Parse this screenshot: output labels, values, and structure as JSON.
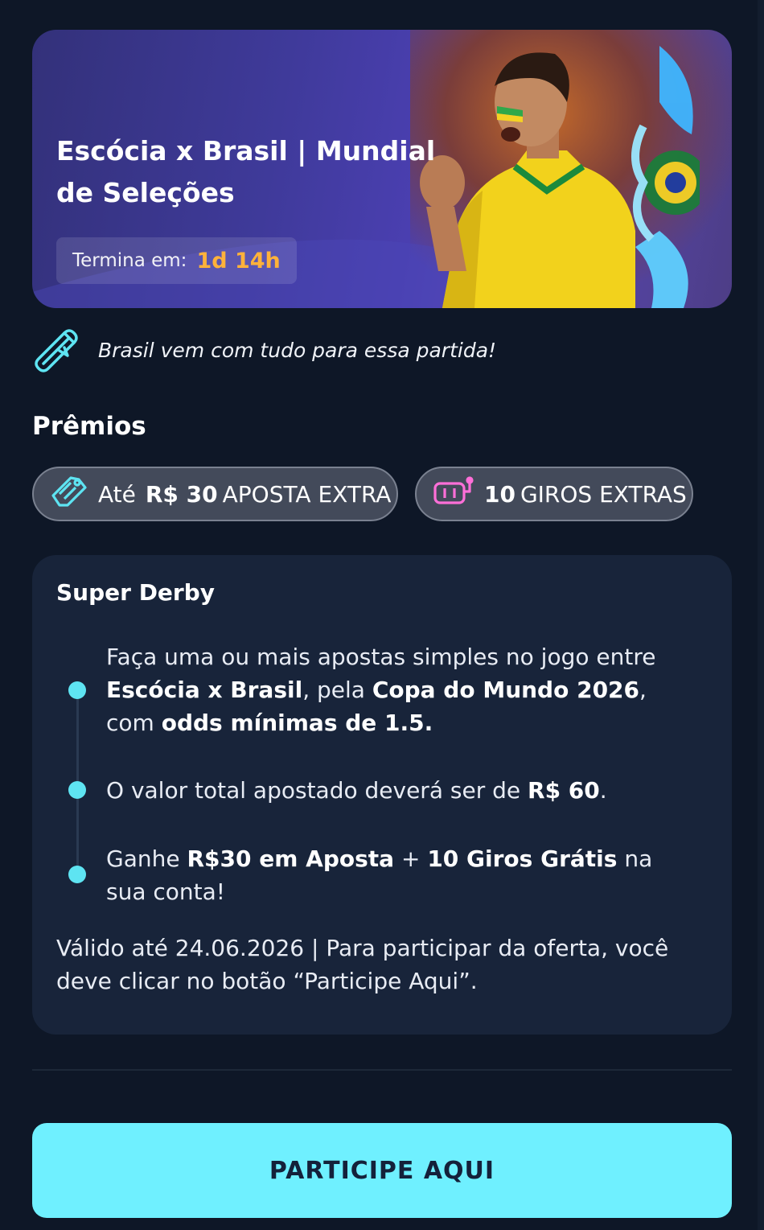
{
  "banner": {
    "title": "Escócia x Brasil | Mundial de Seleções",
    "countdown_label": "Termina em:",
    "countdown_value": "1d 14h"
  },
  "tagline": "Brasil vem com tudo para essa partida!",
  "prizes": {
    "title": "Prêmios",
    "chip_1": {
      "prefix": "Até",
      "amount": "R$ 30",
      "suffix": "APOSTA EXTRA",
      "icon": "ticket-icon"
    },
    "chip_2": {
      "amount": "10",
      "suffix": "GIROS EXTRAS",
      "icon": "slot-machine-icon"
    }
  },
  "card": {
    "title": "Super Derby",
    "steps": [
      {
        "t1": "Faça uma ou mais apostas simples no jogo entre ",
        "b1": "Escócia x Brasil",
        "t2": ", pela ",
        "b2": "Copa do Mundo 2026",
        "t3": ", com ",
        "b3": "odds mínimas de 1.5."
      },
      {
        "t1": "O valor total apostado deverá ser de ",
        "b1": "R$ 60",
        "t2": "."
      },
      {
        "t1": "Ganhe ",
        "b1": "R$30 em Aposta",
        "t2": " + ",
        "b2": "10 Giros Grátis",
        "t3": " na sua conta!"
      }
    ],
    "validity": "Válido até 24.06.2026 | Para participar da oferta, você deve clicar no botão “Participe Aqui”."
  },
  "cta_label": "PARTICIPE AQUI",
  "colors": {
    "background": "#0e1727",
    "card": "#18243a",
    "accent": "#6ff0ff",
    "countdown": "#ffb23a"
  }
}
